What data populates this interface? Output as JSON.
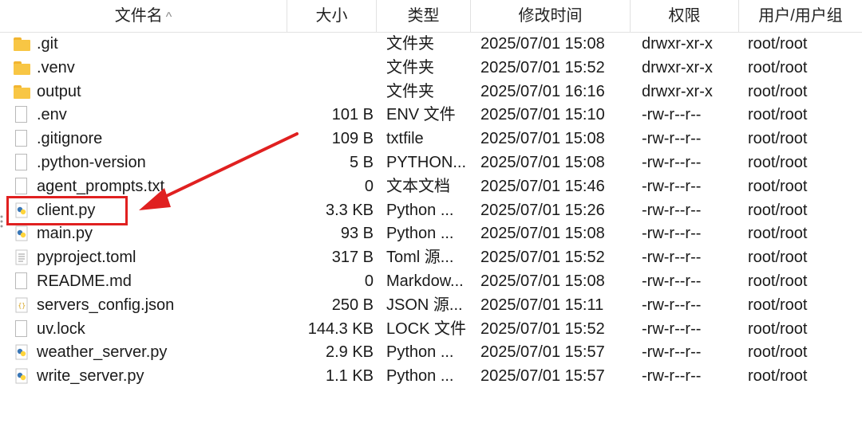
{
  "columns": {
    "name": "文件名",
    "size": "大小",
    "type": "类型",
    "modified": "修改时间",
    "permissions": "权限",
    "owner": "用户/用户组"
  },
  "sort_indicator": "^",
  "colors": {
    "folder": "#f8c644",
    "annotation": "#e02020",
    "python_blue": "#3a77b6",
    "python_yellow": "#ffd43b"
  },
  "files": [
    {
      "name": ".git",
      "size": "",
      "type": "文件夹",
      "modified": "2025/07/01 15:08",
      "permissions": "drwxr-xr-x",
      "owner": "root/root",
      "icon": "folder-icon"
    },
    {
      "name": ".venv",
      "size": "",
      "type": "文件夹",
      "modified": "2025/07/01 15:52",
      "permissions": "drwxr-xr-x",
      "owner": "root/root",
      "icon": "folder-icon"
    },
    {
      "name": "output",
      "size": "",
      "type": "文件夹",
      "modified": "2025/07/01 16:16",
      "permissions": "drwxr-xr-x",
      "owner": "root/root",
      "icon": "folder-icon"
    },
    {
      "name": ".env",
      "size": "101 B",
      "type": "ENV 文件",
      "modified": "2025/07/01 15:10",
      "permissions": "-rw-r--r--",
      "owner": "root/root",
      "icon": "file-icon"
    },
    {
      "name": ".gitignore",
      "size": "109 B",
      "type": "txtfile",
      "modified": "2025/07/01 15:08",
      "permissions": "-rw-r--r--",
      "owner": "root/root",
      "icon": "file-icon"
    },
    {
      "name": ".python-version",
      "size": "5 B",
      "type": "PYTHON...",
      "modified": "2025/07/01 15:08",
      "permissions": "-rw-r--r--",
      "owner": "root/root",
      "icon": "file-icon"
    },
    {
      "name": "agent_prompts.txt",
      "size": "0",
      "type": "文本文档",
      "modified": "2025/07/01 15:46",
      "permissions": "-rw-r--r--",
      "owner": "root/root",
      "icon": "file-icon"
    },
    {
      "name": "client.py",
      "size": "3.3 KB",
      "type": "Python ...",
      "modified": "2025/07/01 15:26",
      "permissions": "-rw-r--r--",
      "owner": "root/root",
      "icon": "python-icon"
    },
    {
      "name": "main.py",
      "size": "93 B",
      "type": "Python ...",
      "modified": "2025/07/01 15:08",
      "permissions": "-rw-r--r--",
      "owner": "root/root",
      "icon": "python-icon"
    },
    {
      "name": "pyproject.toml",
      "size": "317 B",
      "type": "Toml 源...",
      "modified": "2025/07/01 15:52",
      "permissions": "-rw-r--r--",
      "owner": "root/root",
      "icon": "toml-icon"
    },
    {
      "name": "README.md",
      "size": "0",
      "type": "Markdow...",
      "modified": "2025/07/01 15:08",
      "permissions": "-rw-r--r--",
      "owner": "root/root",
      "icon": "file-icon"
    },
    {
      "name": "servers_config.json",
      "size": "250 B",
      "type": "JSON 源...",
      "modified": "2025/07/01 15:11",
      "permissions": "-rw-r--r--",
      "owner": "root/root",
      "icon": "json-icon"
    },
    {
      "name": "uv.lock",
      "size": "144.3 KB",
      "type": "LOCK 文件",
      "modified": "2025/07/01 15:52",
      "permissions": "-rw-r--r--",
      "owner": "root/root",
      "icon": "file-icon"
    },
    {
      "name": "weather_server.py",
      "size": "2.9 KB",
      "type": "Python ...",
      "modified": "2025/07/01 15:57",
      "permissions": "-rw-r--r--",
      "owner": "root/root",
      "icon": "python-icon"
    },
    {
      "name": "write_server.py",
      "size": "1.1 KB",
      "type": "Python ...",
      "modified": "2025/07/01 15:57",
      "permissions": "-rw-r--r--",
      "owner": "root/root",
      "icon": "python-icon"
    }
  ],
  "annotation": {
    "highlighted_file": "client.py"
  }
}
